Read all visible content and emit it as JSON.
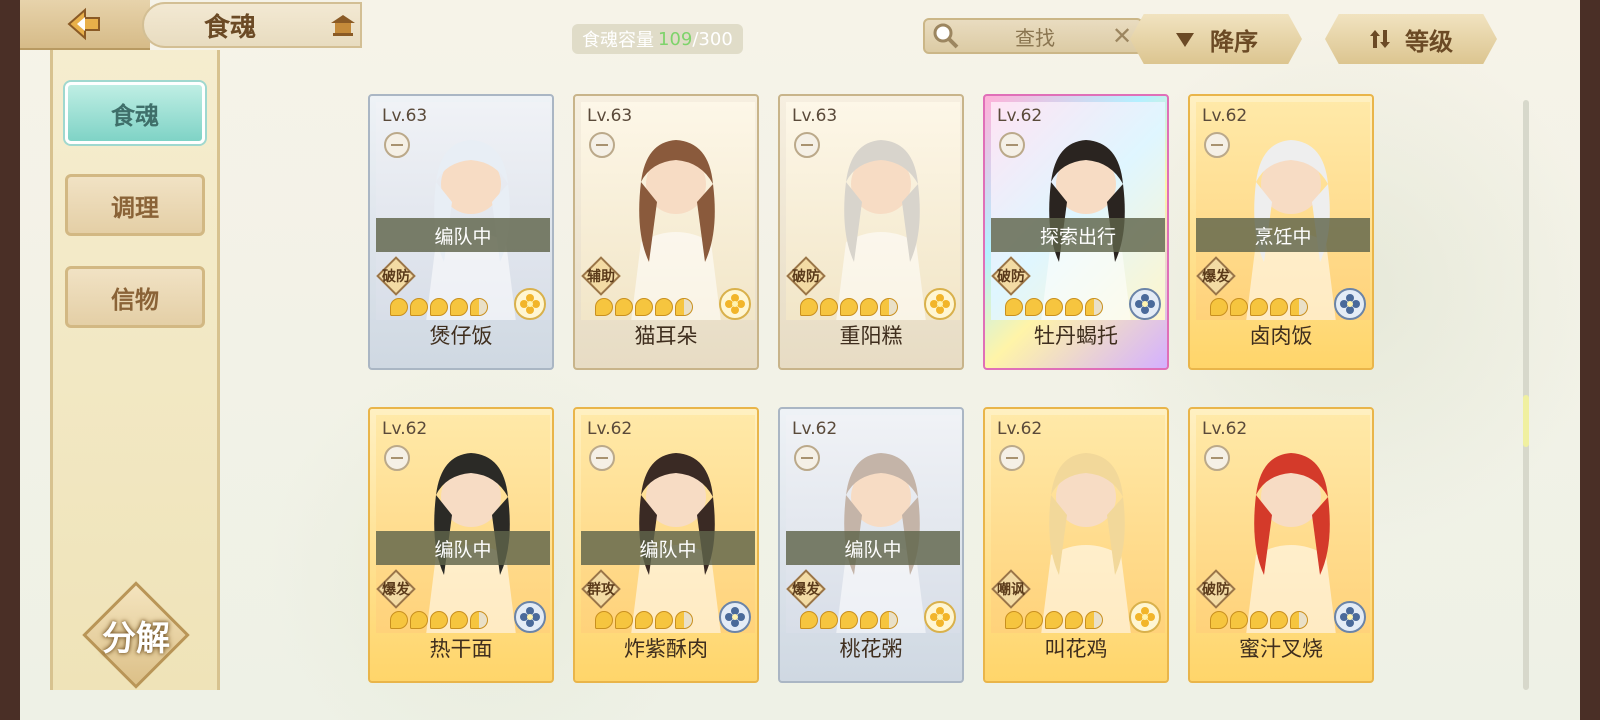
{
  "header": {
    "title": "食魂",
    "capacity_label": "食魂容量",
    "capacity_current": "109",
    "capacity_total": "/300",
    "search_placeholder": "查找",
    "sort_order_label": "降序",
    "sort_key_label": "等级"
  },
  "sidebar": {
    "tabs": [
      {
        "label": "食魂",
        "active": true
      },
      {
        "label": "调理",
        "active": false
      },
      {
        "label": "信物",
        "active": false
      }
    ],
    "decompose_label": "分解"
  },
  "colors": {
    "accent_teal": "#7fd3c6",
    "gold_frame": "#e9b54a",
    "capacity_green": "#7ed36b"
  },
  "cards": [
    {
      "level": "Lv.63",
      "name": "煲仔饭",
      "status": "编队中",
      "role": "破防",
      "frame": "silver",
      "stars": 4,
      "rarity_icon": "gold-flower-icon",
      "hair": "#e8eef5"
    },
    {
      "level": "Lv.63",
      "name": "猫耳朵",
      "status": "",
      "role": "辅助",
      "frame": "pale",
      "stars": 4,
      "rarity_icon": "gold-flower-icon",
      "hair": "#8a5a3c"
    },
    {
      "level": "Lv.63",
      "name": "重阳糕",
      "status": "",
      "role": "破防",
      "frame": "pale",
      "stars": 4,
      "rarity_icon": "gold-flower-icon",
      "hair": "#d8d4cc"
    },
    {
      "level": "Lv.62",
      "name": "牡丹蝎托",
      "status": "探索出行",
      "role": "破防",
      "frame": "rainbow",
      "stars": 4,
      "rarity_icon": "blue-flower-icon",
      "hair": "#2a2420"
    },
    {
      "level": "Lv.62",
      "name": "卤肉饭",
      "status": "烹饪中",
      "role": "爆发",
      "frame": "gold",
      "stars": 4,
      "rarity_icon": "blue-flower-icon",
      "hair": "#eeeeee"
    },
    {
      "level": "Lv.62",
      "name": "热干面",
      "status": "编队中",
      "role": "爆发",
      "frame": "gold",
      "stars": 4,
      "rarity_icon": "blue-flower-icon",
      "hair": "#2b2a26"
    },
    {
      "level": "Lv.62",
      "name": "炸紫酥肉",
      "status": "编队中",
      "role": "群攻",
      "frame": "gold",
      "stars": 4,
      "rarity_icon": "blue-flower-icon",
      "hair": "#3a2a24"
    },
    {
      "level": "Lv.62",
      "name": "桃花粥",
      "status": "编队中",
      "role": "爆发",
      "frame": "silver",
      "stars": 4,
      "rarity_icon": "gold-flower-icon",
      "hair": "#c4b4a8"
    },
    {
      "level": "Lv.62",
      "name": "叫花鸡",
      "status": "",
      "role": "嘲讽",
      "frame": "gold",
      "stars": 4,
      "rarity_icon": "gold-flower-icon",
      "hair": "#f2d89a"
    },
    {
      "level": "Lv.62",
      "name": "蜜汁叉烧",
      "status": "",
      "role": "破防",
      "frame": "gold",
      "stars": 4,
      "rarity_icon": "blue-flower-icon",
      "hair": "#d43a2a"
    }
  ]
}
